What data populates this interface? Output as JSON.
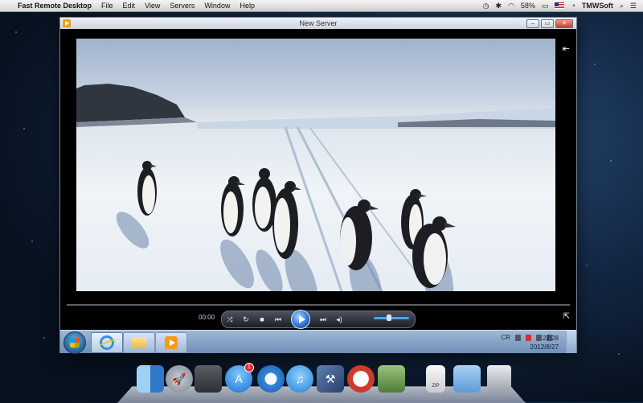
{
  "menubar": {
    "app_name": "Fast Remote Desktop",
    "menus": [
      "File",
      "Edit",
      "View",
      "Servers",
      "Window",
      "Help"
    ],
    "battery": "58%",
    "user": "TMWSoft",
    "icons": [
      "time-machine-icon",
      "bluetooth-icon",
      "wifi-icon",
      "battery-icon",
      "us-flag-icon",
      "clock-icon",
      "search-icon",
      "list-icon"
    ]
  },
  "window": {
    "title": "New Server"
  },
  "player": {
    "time": "00:00",
    "accent": "#1e5fc4"
  },
  "taskbar": {
    "lang": "CR",
    "time": "22:28",
    "date": "2012/8/27"
  },
  "dock": {
    "appstore_badge": "1",
    "zip_label": "ZIP"
  }
}
